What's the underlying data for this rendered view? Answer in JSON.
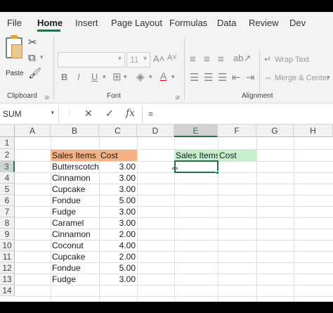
{
  "ribbon_tabs": [
    "File",
    "Home",
    "Insert",
    "Page Layout",
    "Formulas",
    "Data",
    "Review",
    "Dev"
  ],
  "active_tab": "Home",
  "groups": {
    "clipboard": "Clipboard",
    "font": "Font",
    "alignment": "Alignment"
  },
  "clipboard": {
    "paste_label": "Paste"
  },
  "font": {
    "font_name": "",
    "font_size": "11"
  },
  "alignment": {
    "wrap_text": "Wrap Text",
    "merge_center": "Merge & Center"
  },
  "formula_bar": {
    "name_box": "SUM",
    "formula": "="
  },
  "columns": [
    "A",
    "B",
    "C",
    "D",
    "E",
    "F",
    "G",
    "H"
  ],
  "rows": [
    "1",
    "2",
    "3",
    "4",
    "5",
    "6",
    "7",
    "8",
    "9",
    "10",
    "11",
    "12",
    "13",
    "14"
  ],
  "selected_column": "E",
  "selected_row": "3",
  "table": {
    "header_item": "Sales Items",
    "header_cost": "Cost",
    "rows": [
      {
        "item": "Butterscotch",
        "cost": "3.00"
      },
      {
        "item": "Cinnamon",
        "cost": "3.00"
      },
      {
        "item": "Cupcake",
        "cost": "3.00"
      },
      {
        "item": "Fondue",
        "cost": "5.00"
      },
      {
        "item": "Fudge",
        "cost": "3.00"
      },
      {
        "item": "Caramel",
        "cost": "3.00"
      },
      {
        "item": "Cinnamon",
        "cost": "2.00"
      },
      {
        "item": "Coconut",
        "cost": "4.00"
      },
      {
        "item": "Cupcake",
        "cost": "2.00"
      },
      {
        "item": "Fondue",
        "cost": "5.00"
      },
      {
        "item": "Fudge",
        "cost": "3.00"
      }
    ]
  },
  "summary": {
    "header_item": "Sales Items",
    "header_cost": "Cost"
  },
  "colors": {
    "accent": "#217346",
    "header_orange": "#f4b183",
    "header_green": "#c6efce"
  }
}
